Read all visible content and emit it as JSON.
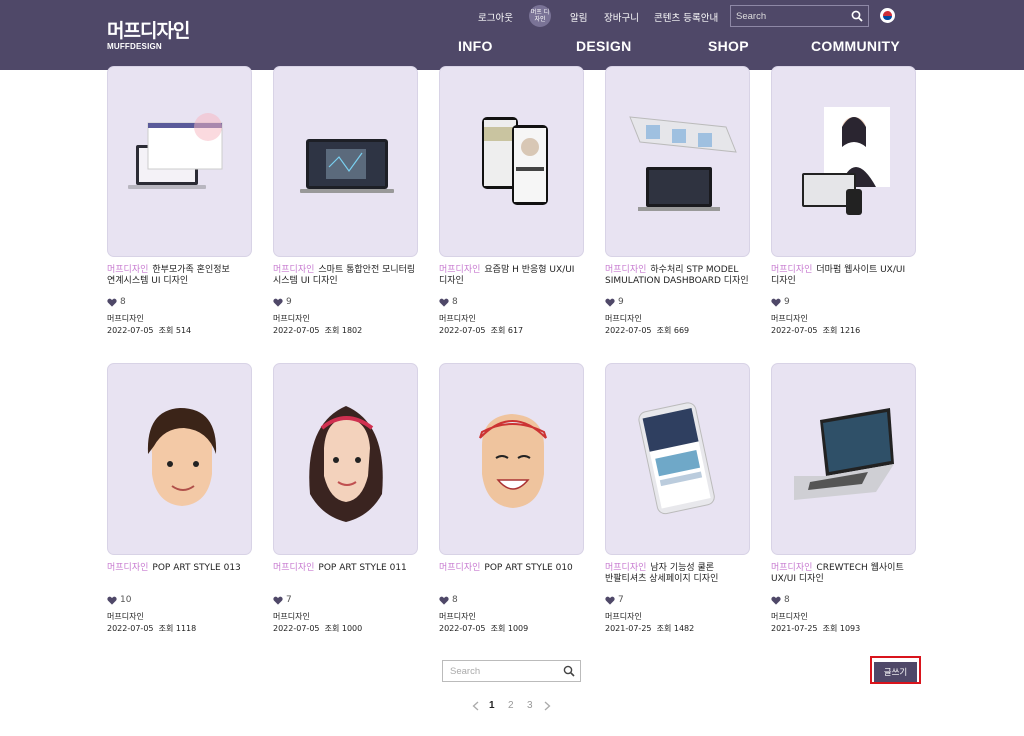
{
  "header": {
    "logo_ko": "머프디자인",
    "logo_en": "MUFFDESIGN",
    "util": {
      "logout": "로그아웃",
      "badge": "머프 디자인",
      "alarm": "알림",
      "cart": "장바구니",
      "content_register": "콘텐츠 등록안내"
    },
    "search_placeholder": "Search",
    "nav": [
      "INFO",
      "DESIGN",
      "SHOP",
      "COMMUNITY"
    ]
  },
  "cards": [
    {
      "category": "머프디자인",
      "title": "한부모가족 혼인정보 연계시스템 UI 디자인",
      "likes": "8",
      "author": "머프디자인",
      "date": "2022-07-05",
      "views_label": "조회 514"
    },
    {
      "category": "머프디자인",
      "title": "스마트 통합안전 모니터링 시스템 UI 디자인",
      "likes": "9",
      "author": "머프디자인",
      "date": "2022-07-05",
      "views_label": "조회 1802"
    },
    {
      "category": "머프디자인",
      "title": "요즘맘 H 반응형 UX/UI 디자인",
      "likes": "8",
      "author": "머프디자인",
      "date": "2022-07-05",
      "views_label": "조회 617"
    },
    {
      "category": "머프디자인",
      "title": "하수처리 STP MODEL SIMULATION DASHBOARD 디자인",
      "likes": "9",
      "author": "머프디자인",
      "date": "2022-07-05",
      "views_label": "조회 669"
    },
    {
      "category": "머프디자인",
      "title": "더마펌 웹사이트 UX/UI 디자인",
      "likes": "9",
      "author": "머프디자인",
      "date": "2022-07-05",
      "views_label": "조회 1216"
    },
    {
      "category": "머프디자인",
      "title": "POP ART STYLE 013",
      "likes": "10",
      "author": "머프디자인",
      "date": "2022-07-05",
      "views_label": "조회 1118"
    },
    {
      "category": "머프디자인",
      "title": "POP ART STYLE 011",
      "likes": "7",
      "author": "머프디자인",
      "date": "2022-07-05",
      "views_label": "조회 1000"
    },
    {
      "category": "머프디자인",
      "title": "POP ART STYLE 010",
      "likes": "8",
      "author": "머프디자인",
      "date": "2022-07-05",
      "views_label": "조회 1009"
    },
    {
      "category": "머프디자인",
      "title": "남자 기능성 쿨론 반팔티셔츠 상세페이지 디자인",
      "likes": "7",
      "author": "머프디자인",
      "date": "2021-07-25",
      "views_label": "조회 1482"
    },
    {
      "category": "머프디자인",
      "title": "CREWTECH 웹사이트 UX/UI 디자인",
      "likes": "8",
      "author": "머프디자인",
      "date": "2021-07-25",
      "views_label": "조회 1093"
    }
  ],
  "bottom": {
    "search_placeholder": "Search",
    "write_label": "글쓰기",
    "pages": [
      "1",
      "2",
      "3"
    ],
    "current_page": "1"
  },
  "colors": {
    "header_bg": "#4f4868",
    "thumb_bg": "#e8e3f2",
    "category": "#c77ad0",
    "heart": "#4f4868",
    "highlight": "#d9141c"
  },
  "icons": {
    "search": "search-icon",
    "flag": "korea-flag-icon",
    "like": "heart-icon",
    "prev": "chevron-left-icon",
    "next": "chevron-right-icon"
  }
}
